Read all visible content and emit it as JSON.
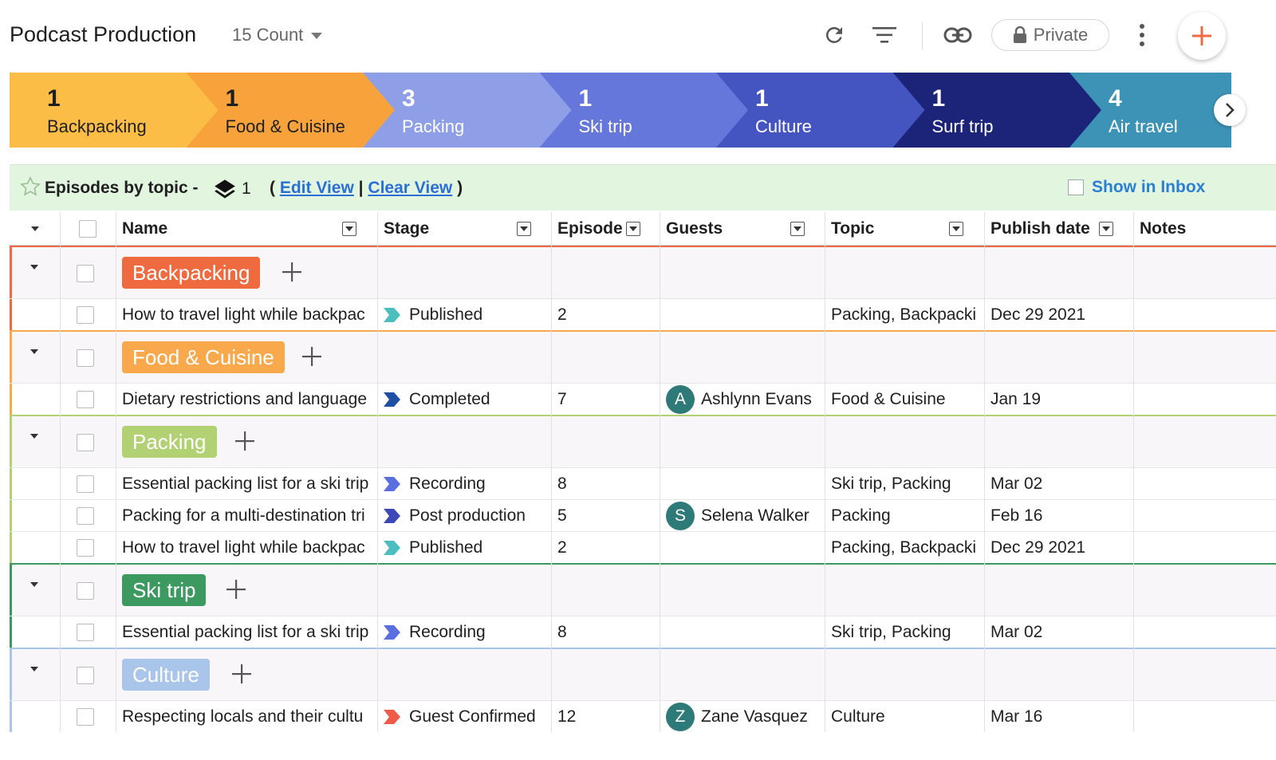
{
  "header": {
    "title": "Podcast Production",
    "count_label": "15 Count",
    "private_label": "Private"
  },
  "icons": [
    "refresh-icon",
    "filter-icon",
    "link-icon",
    "lock-icon",
    "more-vertical-icon",
    "plus-icon",
    "chevron-right-icon",
    "star-icon",
    "layers-icon"
  ],
  "pipeline": [
    {
      "count": "1",
      "name": "Backpacking",
      "color": "#fbbd45",
      "text": "#1f1f1f"
    },
    {
      "count": "1",
      "name": "Food & Cuisine",
      "color": "#f7a23b",
      "text": "#1f1f1f"
    },
    {
      "count": "3",
      "name": "Packing",
      "color": "#8e9fe8",
      "text": "#ffffff"
    },
    {
      "count": "1",
      "name": "Ski trip",
      "color": "#6577db",
      "text": "#ffffff"
    },
    {
      "count": "1",
      "name": "Culture",
      "color": "#4455c2",
      "text": "#ffffff"
    },
    {
      "count": "1",
      "name": "Surf trip",
      "color": "#1c2479",
      "text": "#ffffff"
    },
    {
      "count": "4",
      "name": "Air travel",
      "color": "#3d93b5",
      "text": "#ffffff"
    }
  ],
  "view": {
    "title": "Episodes by topic -",
    "layer_count": "1",
    "open_paren": "(",
    "edit_view": "Edit View",
    "separator": "|",
    "clear_view": "Clear View",
    "close_paren": ")",
    "show_in_inbox": "Show in Inbox"
  },
  "columns": {
    "name": "Name",
    "stage": "Stage",
    "episode": "Episode",
    "guests": "Guests",
    "topic": "Topic",
    "publish_date": "Publish date",
    "notes": "Notes"
  },
  "groups": [
    {
      "label": "Backpacking",
      "color": "#f06a3f",
      "rows": [
        {
          "name": "How to travel light while backpac",
          "stage": "Published",
          "stage_color": "#4bbfc0",
          "episode": "2",
          "guest": "",
          "guest_initial": "",
          "topic": "Packing, Backpacki",
          "date": "Dec 29 2021"
        }
      ]
    },
    {
      "label": "Food & Cuisine",
      "color": "#f9a84b",
      "rows": [
        {
          "name": "Dietary restrictions and language",
          "stage": "Completed",
          "stage_color": "#1f4fa5",
          "episode": "7",
          "guest": "Ashlynn Evans",
          "guest_initial": "A",
          "topic": "Food & Cuisine",
          "date": "Jan 19"
        }
      ]
    },
    {
      "label": "Packing",
      "color": "#b2d172",
      "rows": [
        {
          "name": "Essential packing list for a ski trip",
          "stage": "Recording",
          "stage_color": "#5b6ee0",
          "episode": "8",
          "guest": "",
          "guest_initial": "",
          "topic": "Ski trip, Packing",
          "date": "Mar 02"
        },
        {
          "name": "Packing for a multi-destination tri",
          "stage": "Post production",
          "stage_color": "#3c48b8",
          "episode": "5",
          "guest": "Selena Walker",
          "guest_initial": "S",
          "topic": "Packing",
          "date": "Feb 16"
        },
        {
          "name": "How to travel light while backpac",
          "stage": "Published",
          "stage_color": "#4bbfc0",
          "episode": "2",
          "guest": "",
          "guest_initial": "",
          "topic": "Packing, Backpacki",
          "date": "Dec 29 2021"
        }
      ]
    },
    {
      "label": "Ski trip",
      "color": "#3c9a60",
      "rows": [
        {
          "name": "Essential packing list for a ski trip",
          "stage": "Recording",
          "stage_color": "#5b6ee0",
          "episode": "8",
          "guest": "",
          "guest_initial": "",
          "topic": "Ski trip, Packing",
          "date": "Mar 02"
        }
      ]
    },
    {
      "label": "Culture",
      "color": "#a9c6ea",
      "rows": [
        {
          "name": "Respecting locals and their cultu",
          "stage": "Guest Confirmed",
          "stage_color": "#f05a48",
          "episode": "12",
          "guest": "Zane Vasquez",
          "guest_initial": "Z",
          "topic": "Culture",
          "date": "Mar 16"
        }
      ]
    }
  ]
}
